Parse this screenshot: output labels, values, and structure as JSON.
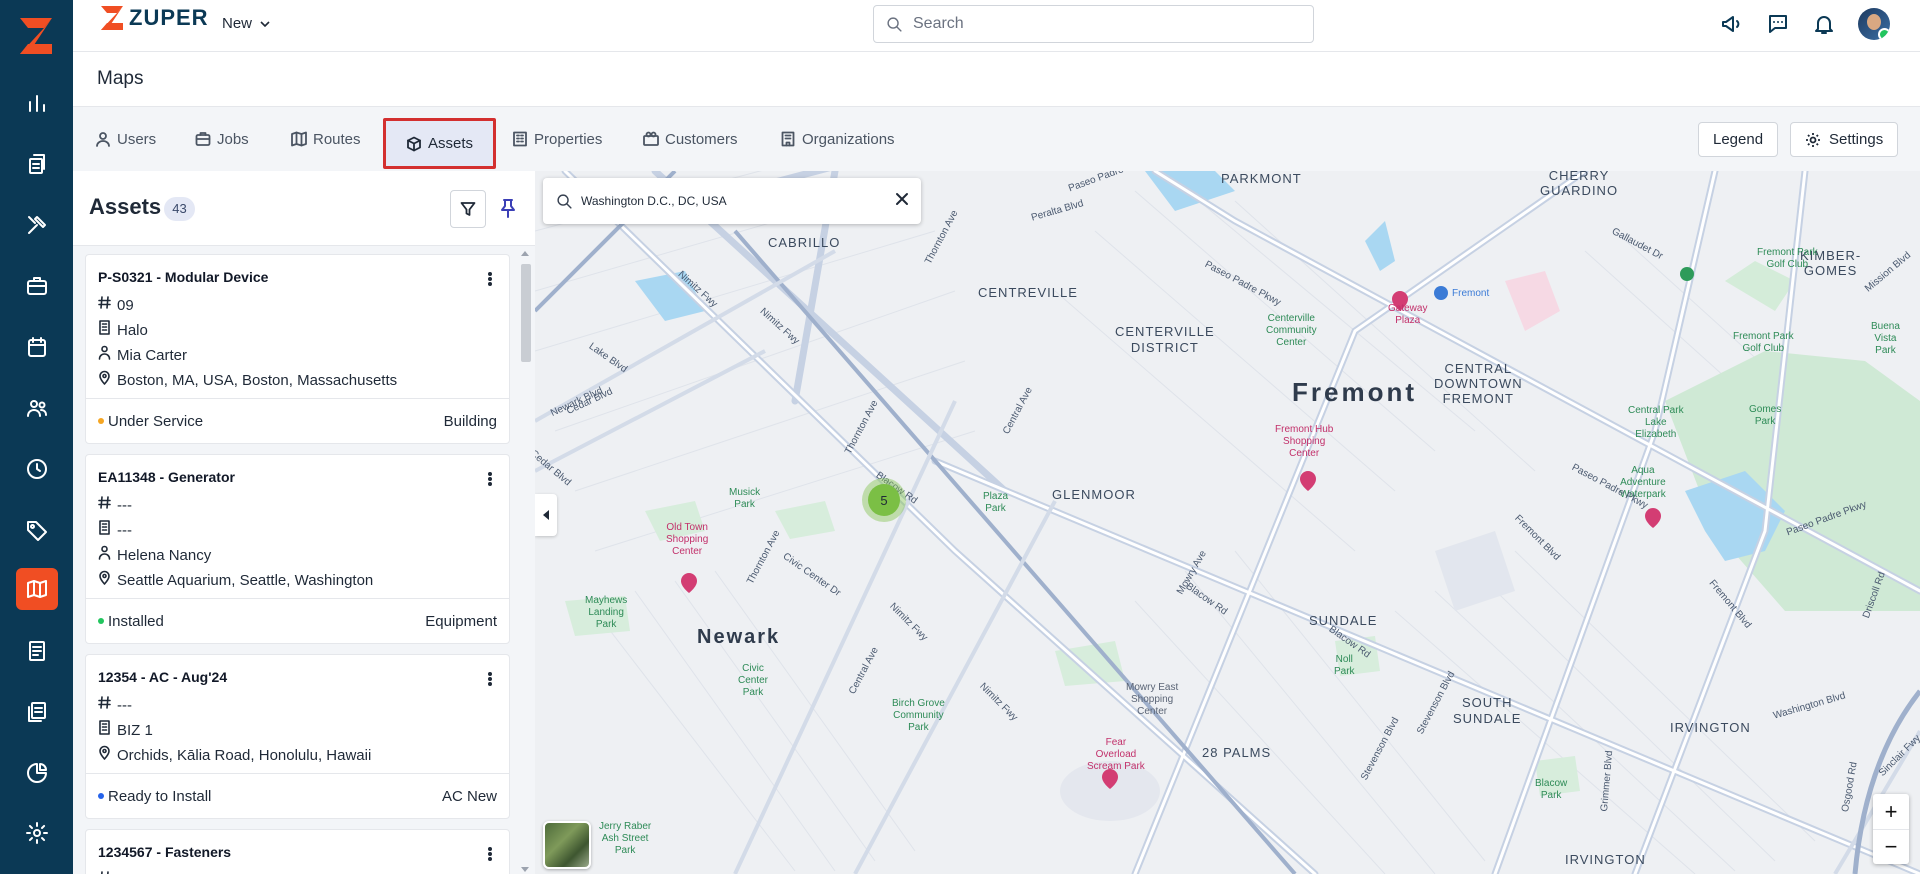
{
  "brand": {
    "name": "ZUPER",
    "new_label": "New"
  },
  "search": {
    "placeholder": "Search"
  },
  "page": {
    "title": "Maps"
  },
  "tabs": [
    {
      "label": "Users",
      "icon": "user-icon"
    },
    {
      "label": "Jobs",
      "icon": "briefcase-icon"
    },
    {
      "label": "Routes",
      "icon": "map-icon"
    },
    {
      "label": "Assets",
      "icon": "box-icon",
      "active": true
    },
    {
      "label": "Properties",
      "icon": "building-icon"
    },
    {
      "label": "Customers",
      "icon": "customers-icon"
    },
    {
      "label": "Organizations",
      "icon": "organization-icon"
    }
  ],
  "actions": {
    "legend": "Legend",
    "settings": "Settings"
  },
  "assets_panel": {
    "title": "Assets",
    "count": "43",
    "cards": [
      {
        "title": "P-S0321 - Modular Device",
        "code": "09",
        "company": "Halo",
        "person": "Mia Carter",
        "location": "Boston, MA, USA, Boston, Massachusetts",
        "status": "Under Service",
        "status_color": "#f5a623",
        "category": "Building"
      },
      {
        "title": "EA11348 - Generator",
        "code": "---",
        "company": "---",
        "person": "Helena Nancy",
        "location": "Seattle Aquarium, Seattle, Washington",
        "status": "Installed",
        "status_color": "#22c55e",
        "category": "Equipment"
      },
      {
        "title": "12354 - AC - Aug'24",
        "code": "---",
        "company": "BIZ 1",
        "location": "Orchids, Kālia Road, Honolulu, Hawaii",
        "status": "Ready to Install",
        "status_color": "#2563eb",
        "category": "AC New"
      },
      {
        "title": "1234567 - Fasteners"
      }
    ]
  },
  "map": {
    "search_value": "Washington D.C., DC, USA",
    "cluster_count": "5",
    "zoom_in": "+",
    "zoom_out": "−",
    "labels": {
      "parkmont": "PARKMONT",
      "cherry_guardino": "CHERRY\nGUARDINO",
      "cabrillo": "CABRILLO",
      "centreville": "CENTREVILLE",
      "centerville_district": "CENTERVILLE\nDISTRICT",
      "fremont": "Fremont",
      "central_downtown": "CENTRAL\nDOWNTOWN\nFREMONT",
      "kimber_gomes": "KIMBER-\nGOMES",
      "glenmoor": "GLENMOOR",
      "newark": "Newark",
      "sundale": "SUNDALE",
      "south_sundale": "SOUTH\nSUNDALE",
      "irvington": "IRVINGTON",
      "irvington_2": "IRVINGTON",
      "palms": "28 PALMS",
      "gateway_plaza": "Gateway\nPlaza",
      "fremont_hub": "Fremont Hub\nShopping\nCenter",
      "old_town": "Old Town\nShopping\nCenter",
      "fear_overload": "Fear\nOverload\nScream Park",
      "aqua_adventure": "Aqua\nAdventure\nWaterpark",
      "central_park": "Central Park\nLake\nElizabeth",
      "fremont_park_golf": "Fremont Park\nGolf Club",
      "fremont_park_golf_2": "Fremont Park\nGolf Club",
      "centerville_community": "Centerville\nCommunity\nCenter",
      "musick_park": "Musick\nPark",
      "plaza_park": "Plaza\nPark",
      "mayhews_landing": "Mayhews\nLanding\nPark",
      "civic_center": "Civic\nCenter\nPark",
      "birch_grove": "Birch Grove\nCommunity\nPark",
      "mowry_east": "Mowry East\nShopping\nCenter",
      "noll_park": "Noll\nPark",
      "blacow_park": "Blacow\nPark",
      "jerry_raber": "Jerry Raber\nAsh Street\nPark",
      "buena_vista": "Buena\nVista\nPark",
      "gomes_park": "Gomes\nPark",
      "fremont_station": "Fremont",
      "roads": {
        "paseo_padre": "Paseo Padre Pkwy",
        "paseo_padre_2": "Paseo Padre Pkwy",
        "paseo_padre_3": "Paseo Padre Pkwy",
        "paseo_padre_4": "Paseo Padre Pkwy",
        "peralta": "Peralta Blvd",
        "thornton": "Thornton Ave",
        "thornton_2": "Thornton Ave",
        "thornton_3": "Thornton Ave",
        "nimitz": "Nimitz Fwy",
        "nimitz_2": "Nimitz Fwy",
        "nimitz_3": "Nimitz Fwy",
        "nimitz_4": "Nimitz Fwy",
        "central_ave": "Central Ave",
        "central_ave_2": "Central Ave",
        "blacow": "Blacow Rd",
        "blacow_2": "Blacow Rd",
        "blacow_3": "Blacow Rd",
        "cedar": "Cedar Blvd",
        "cedar_2": "Cedar Blvd",
        "lake": "Lake Blvd",
        "fremont_blvd": "Fremont Blvd",
        "fremont_blvd_2": "Fremont Blvd",
        "mowry": "Mowry Ave",
        "stevenson": "Stevenson Blvd",
        "stevenson_2": "Stevenson Blvd",
        "washington": "Washington Blvd",
        "gallaudet": "Gallaudet Dr",
        "grimmer": "Grimmer Blvd",
        "osgood": "Osgood Rd",
        "driscoll": "Driscoll Rd",
        "sinclair": "Sinclair Fwy",
        "newark_blvd": "Newark Blvd",
        "civic_center_dr": "Civic Center Dr",
        "mission_blvd": "Mission Blvd"
      }
    }
  }
}
